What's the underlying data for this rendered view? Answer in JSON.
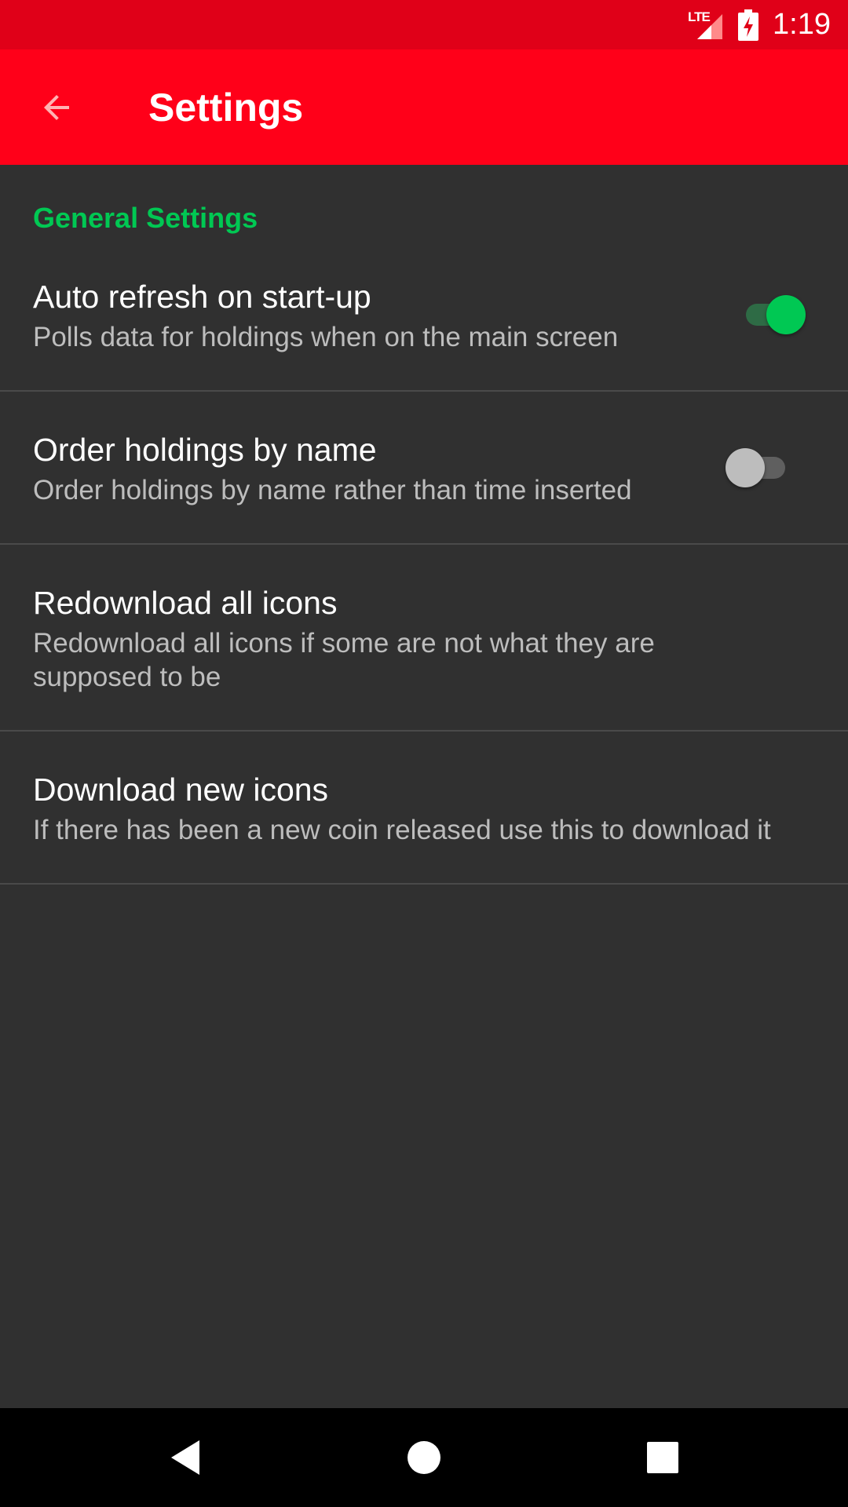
{
  "status_bar": {
    "network": "LTE",
    "time": "1:19",
    "color": "#e00018",
    "icons": [
      "lte-signal-icon",
      "battery-charging-icon"
    ]
  },
  "app_bar": {
    "title": "Settings",
    "back_icon": "arrow-back-icon",
    "color": "#ff0019"
  },
  "section": {
    "header": "General Settings",
    "accent_color": "#00c853"
  },
  "preferences": [
    {
      "title": "Auto refresh on start-up",
      "summary": "Polls data for holdings when on the main screen",
      "switch_on": true
    },
    {
      "title": "Order holdings by name",
      "summary": "Order holdings by name rather than time inserted",
      "switch_on": false
    },
    {
      "title": "Redownload all icons",
      "summary": "Redownload all icons if some are not what they are supposed to be"
    },
    {
      "title": "Download new icons",
      "summary": "If there has been a new coin released use this to download it"
    }
  ],
  "nav_bar": {
    "icons": [
      "back-triangle-icon",
      "home-circle-icon",
      "recents-square-icon"
    ]
  }
}
